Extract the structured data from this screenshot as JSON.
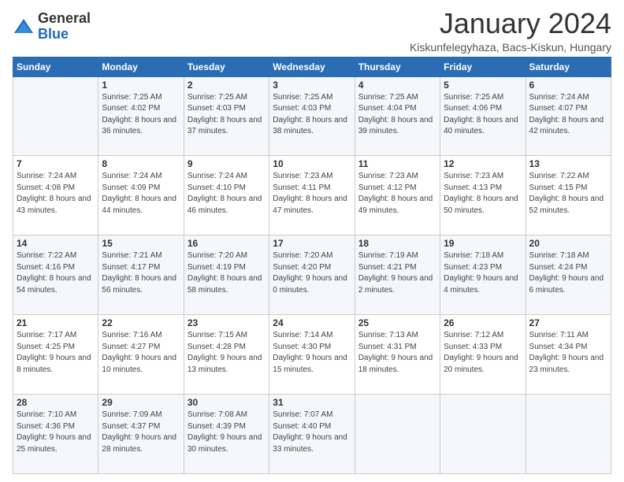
{
  "logo": {
    "general": "General",
    "blue": "Blue"
  },
  "header": {
    "month": "January 2024",
    "location": "Kiskunfelegyhaza, Bacs-Kiskun, Hungary"
  },
  "weekdays": [
    "Sunday",
    "Monday",
    "Tuesday",
    "Wednesday",
    "Thursday",
    "Friday",
    "Saturday"
  ],
  "weeks": [
    [
      {
        "day": "",
        "sunrise": "",
        "sunset": "",
        "daylight": ""
      },
      {
        "day": "1",
        "sunrise": "Sunrise: 7:25 AM",
        "sunset": "Sunset: 4:02 PM",
        "daylight": "Daylight: 8 hours and 36 minutes."
      },
      {
        "day": "2",
        "sunrise": "Sunrise: 7:25 AM",
        "sunset": "Sunset: 4:03 PM",
        "daylight": "Daylight: 8 hours and 37 minutes."
      },
      {
        "day": "3",
        "sunrise": "Sunrise: 7:25 AM",
        "sunset": "Sunset: 4:03 PM",
        "daylight": "Daylight: 8 hours and 38 minutes."
      },
      {
        "day": "4",
        "sunrise": "Sunrise: 7:25 AM",
        "sunset": "Sunset: 4:04 PM",
        "daylight": "Daylight: 8 hours and 39 minutes."
      },
      {
        "day": "5",
        "sunrise": "Sunrise: 7:25 AM",
        "sunset": "Sunset: 4:06 PM",
        "daylight": "Daylight: 8 hours and 40 minutes."
      },
      {
        "day": "6",
        "sunrise": "Sunrise: 7:24 AM",
        "sunset": "Sunset: 4:07 PM",
        "daylight": "Daylight: 8 hours and 42 minutes."
      }
    ],
    [
      {
        "day": "7",
        "sunrise": "Sunrise: 7:24 AM",
        "sunset": "Sunset: 4:08 PM",
        "daylight": "Daylight: 8 hours and 43 minutes."
      },
      {
        "day": "8",
        "sunrise": "Sunrise: 7:24 AM",
        "sunset": "Sunset: 4:09 PM",
        "daylight": "Daylight: 8 hours and 44 minutes."
      },
      {
        "day": "9",
        "sunrise": "Sunrise: 7:24 AM",
        "sunset": "Sunset: 4:10 PM",
        "daylight": "Daylight: 8 hours and 46 minutes."
      },
      {
        "day": "10",
        "sunrise": "Sunrise: 7:23 AM",
        "sunset": "Sunset: 4:11 PM",
        "daylight": "Daylight: 8 hours and 47 minutes."
      },
      {
        "day": "11",
        "sunrise": "Sunrise: 7:23 AM",
        "sunset": "Sunset: 4:12 PM",
        "daylight": "Daylight: 8 hours and 49 minutes."
      },
      {
        "day": "12",
        "sunrise": "Sunrise: 7:23 AM",
        "sunset": "Sunset: 4:13 PM",
        "daylight": "Daylight: 8 hours and 50 minutes."
      },
      {
        "day": "13",
        "sunrise": "Sunrise: 7:22 AM",
        "sunset": "Sunset: 4:15 PM",
        "daylight": "Daylight: 8 hours and 52 minutes."
      }
    ],
    [
      {
        "day": "14",
        "sunrise": "Sunrise: 7:22 AM",
        "sunset": "Sunset: 4:16 PM",
        "daylight": "Daylight: 8 hours and 54 minutes."
      },
      {
        "day": "15",
        "sunrise": "Sunrise: 7:21 AM",
        "sunset": "Sunset: 4:17 PM",
        "daylight": "Daylight: 8 hours and 56 minutes."
      },
      {
        "day": "16",
        "sunrise": "Sunrise: 7:20 AM",
        "sunset": "Sunset: 4:19 PM",
        "daylight": "Daylight: 8 hours and 58 minutes."
      },
      {
        "day": "17",
        "sunrise": "Sunrise: 7:20 AM",
        "sunset": "Sunset: 4:20 PM",
        "daylight": "Daylight: 9 hours and 0 minutes."
      },
      {
        "day": "18",
        "sunrise": "Sunrise: 7:19 AM",
        "sunset": "Sunset: 4:21 PM",
        "daylight": "Daylight: 9 hours and 2 minutes."
      },
      {
        "day": "19",
        "sunrise": "Sunrise: 7:18 AM",
        "sunset": "Sunset: 4:23 PM",
        "daylight": "Daylight: 9 hours and 4 minutes."
      },
      {
        "day": "20",
        "sunrise": "Sunrise: 7:18 AM",
        "sunset": "Sunset: 4:24 PM",
        "daylight": "Daylight: 9 hours and 6 minutes."
      }
    ],
    [
      {
        "day": "21",
        "sunrise": "Sunrise: 7:17 AM",
        "sunset": "Sunset: 4:25 PM",
        "daylight": "Daylight: 9 hours and 8 minutes."
      },
      {
        "day": "22",
        "sunrise": "Sunrise: 7:16 AM",
        "sunset": "Sunset: 4:27 PM",
        "daylight": "Daylight: 9 hours and 10 minutes."
      },
      {
        "day": "23",
        "sunrise": "Sunrise: 7:15 AM",
        "sunset": "Sunset: 4:28 PM",
        "daylight": "Daylight: 9 hours and 13 minutes."
      },
      {
        "day": "24",
        "sunrise": "Sunrise: 7:14 AM",
        "sunset": "Sunset: 4:30 PM",
        "daylight": "Daylight: 9 hours and 15 minutes."
      },
      {
        "day": "25",
        "sunrise": "Sunrise: 7:13 AM",
        "sunset": "Sunset: 4:31 PM",
        "daylight": "Daylight: 9 hours and 18 minutes."
      },
      {
        "day": "26",
        "sunrise": "Sunrise: 7:12 AM",
        "sunset": "Sunset: 4:33 PM",
        "daylight": "Daylight: 9 hours and 20 minutes."
      },
      {
        "day": "27",
        "sunrise": "Sunrise: 7:11 AM",
        "sunset": "Sunset: 4:34 PM",
        "daylight": "Daylight: 9 hours and 23 minutes."
      }
    ],
    [
      {
        "day": "28",
        "sunrise": "Sunrise: 7:10 AM",
        "sunset": "Sunset: 4:36 PM",
        "daylight": "Daylight: 9 hours and 25 minutes."
      },
      {
        "day": "29",
        "sunrise": "Sunrise: 7:09 AM",
        "sunset": "Sunset: 4:37 PM",
        "daylight": "Daylight: 9 hours and 28 minutes."
      },
      {
        "day": "30",
        "sunrise": "Sunrise: 7:08 AM",
        "sunset": "Sunset: 4:39 PM",
        "daylight": "Daylight: 9 hours and 30 minutes."
      },
      {
        "day": "31",
        "sunrise": "Sunrise: 7:07 AM",
        "sunset": "Sunset: 4:40 PM",
        "daylight": "Daylight: 9 hours and 33 minutes."
      },
      {
        "day": "",
        "sunrise": "",
        "sunset": "",
        "daylight": ""
      },
      {
        "day": "",
        "sunrise": "",
        "sunset": "",
        "daylight": ""
      },
      {
        "day": "",
        "sunrise": "",
        "sunset": "",
        "daylight": ""
      }
    ]
  ]
}
